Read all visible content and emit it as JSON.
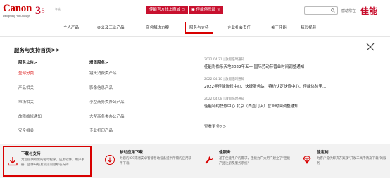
{
  "header": {
    "logo": "Canon",
    "slogan": "Delighting You Always",
    "anniv_label": "年度",
    "promo_buttons": [
      {
        "label": "佳能官方线上商城"
      },
      {
        "label": "佳能俱乐部"
      }
    ],
    "brand_small": "感动常在",
    "brand_big": "佳能"
  },
  "nav": {
    "items": [
      {
        "label": "个人产品"
      },
      {
        "label": "办公及工业产品"
      },
      {
        "label": "商务解决方案"
      },
      {
        "label": "服务与支持"
      },
      {
        "label": "企业社会责任"
      },
      {
        "label": "关于佳能"
      },
      {
        "label": "精彩视频"
      }
    ]
  },
  "panel": {
    "title": "服务与支持首页>>",
    "col1": {
      "heading": "服务公告>",
      "items": [
        "全部分类",
        "产品相关",
        "市场相关",
        "故障维修通知",
        "安全相关"
      ]
    },
    "col2": {
      "heading": "增值服务>",
      "items": [
        "镜头消费类产品",
        "影像信息产品",
        "小型商务类办公产品",
        "大型商务类办公产品",
        "专业打印产品"
      ]
    },
    "news": [
      {
        "meta": "2022.04.21 | 放假临时通知",
        "title": "佳能影像乐天地2022年五一 国际劳动节营业时间调整通知"
      },
      {
        "meta": "2022.04.10 | 放假临时通知",
        "title": "2022年佳能快修中心、快捷服务站、特约认定快修中心、佳能体验里..."
      },
      {
        "meta": "2022.04.08 | 放假临时通知",
        "title": "佳能特约快修中心 北京（西直门店）营业时间调整通知"
      }
    ],
    "more": "查看更多>>"
  },
  "bottom": {
    "cards": [
      {
        "title": "下载与支持",
        "desc": "为您提供所需的驱动程序，应用软件，用户手册，固件升级及常见问题解答支持"
      },
      {
        "title": "移动应用下载",
        "desc": "为您的iOS或者安卓智能移动设备提供所需的应用软件下载"
      },
      {
        "title": "佳服务",
        "desc": "基于佳能用户的需求，佳能为广大用户建立了\"佳能产品注册及服务系统\""
      },
      {
        "title": "佳定制",
        "desc": "为客户提供解决方案及\"开发工具申请及下载\"的服务"
      }
    ]
  },
  "colors": {
    "brand_red": "#c8102e",
    "active_red": "#d80000"
  }
}
